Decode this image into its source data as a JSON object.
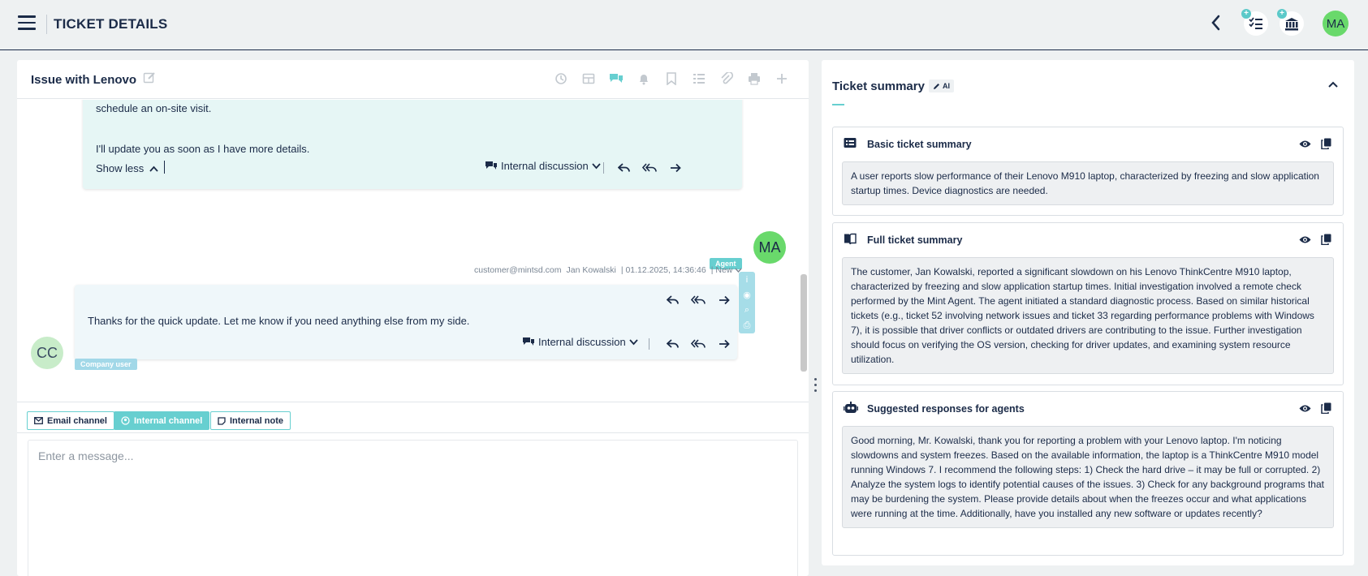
{
  "header": {
    "title": "TICKET DETAILS",
    "avatar_initials": "MA",
    "back_icon": "chevron-left-icon",
    "add_task_icon": "task-list-add-icon",
    "add_institution_icon": "bank-add-icon",
    "plus_glyph": "+"
  },
  "ticket": {
    "title": "Issue with Lenovo",
    "toolbar_icons": [
      "history-icon",
      "table-icon",
      "chat-icon",
      "bell-icon",
      "bookmark-icon",
      "checklist-icon",
      "attachment-icon",
      "print-icon",
      "plus-icon"
    ]
  },
  "conversation": {
    "agent_message": {
      "line1": "schedule an on-site visit.",
      "line2": "I'll update you as soon as I have more details.",
      "show_less": "Show less",
      "internal_discussion": "Internal discussion",
      "avatar_initials": "MA",
      "badge": "Agent"
    },
    "customer_message": {
      "sender_email": "customer@mintsd.com",
      "sender_name": "Jan Kowalski",
      "timestamp": "| 01.12.2025, 14:36:46",
      "status": "| New",
      "text": "Thanks for the quick update. Let me know if you need anything else from my side.",
      "internal_discussion": "Internal discussion",
      "avatar_initials": "CC",
      "badge": "Company user",
      "side_tools": [
        "i",
        "◉",
        "⌕",
        "⎙"
      ]
    }
  },
  "compose": {
    "tabs": [
      {
        "label": "Email channel",
        "icon": "envelope-icon",
        "active": false
      },
      {
        "label": "Internal channel",
        "icon": "circle-icon",
        "active": true
      },
      {
        "label": "Internal note",
        "icon": "note-icon",
        "active": false
      }
    ],
    "placeholder": "Enter a message..."
  },
  "summary": {
    "title": "Ticket summary",
    "ai_badge": "AI",
    "cards": [
      {
        "title": "Basic ticket summary",
        "icon": "id-card-icon",
        "text": "A user reports slow performance of their Lenovo M910 laptop, characterized by freezing and slow application startup times. Device diagnostics are needed."
      },
      {
        "title": "Full ticket summary",
        "icon": "book-icon",
        "text": "The customer, Jan Kowalski, reported a significant slowdown on his Lenovo ThinkCentre M910 laptop, characterized by freezing and slow application startup times. Initial investigation involved a remote check performed by the Mint Agent. The agent initiated a standard diagnostic process. Based on similar historical tickets (e.g., ticket 52 involving network issues and ticket 33 regarding performance problems with Windows 7), it is possible that driver conflicts or outdated drivers are contributing to the issue. Further investigation should focus on verifying the OS version, checking for driver updates, and examining system resource utilization."
      },
      {
        "title": "Suggested responses for agents",
        "icon": "robot-icon",
        "text": "Good morning, Mr. Kowalski, thank you for reporting a problem with your Lenovo laptop. I'm noticing slowdowns and system freezes. Based on the available information, the laptop is a ThinkCentre M910 model running Windows 7. I recommend the following steps: 1) Check the hard drive – it may be full or corrupted. 2) Analyze the system logs to identify potential causes of the issues. 3) Check for any background programs that may be burdening the system. Please provide details about when the freezes occur and what applications were running at the time. Additionally, have you installed any new software or updates recently?"
      }
    ]
  },
  "colors": {
    "navy": "#1b2b48",
    "teal": "#67cfd0",
    "avatar_green": "#69d96b",
    "agent_bubble": "#e6f6f5",
    "customer_bubble": "#eff7fa"
  }
}
